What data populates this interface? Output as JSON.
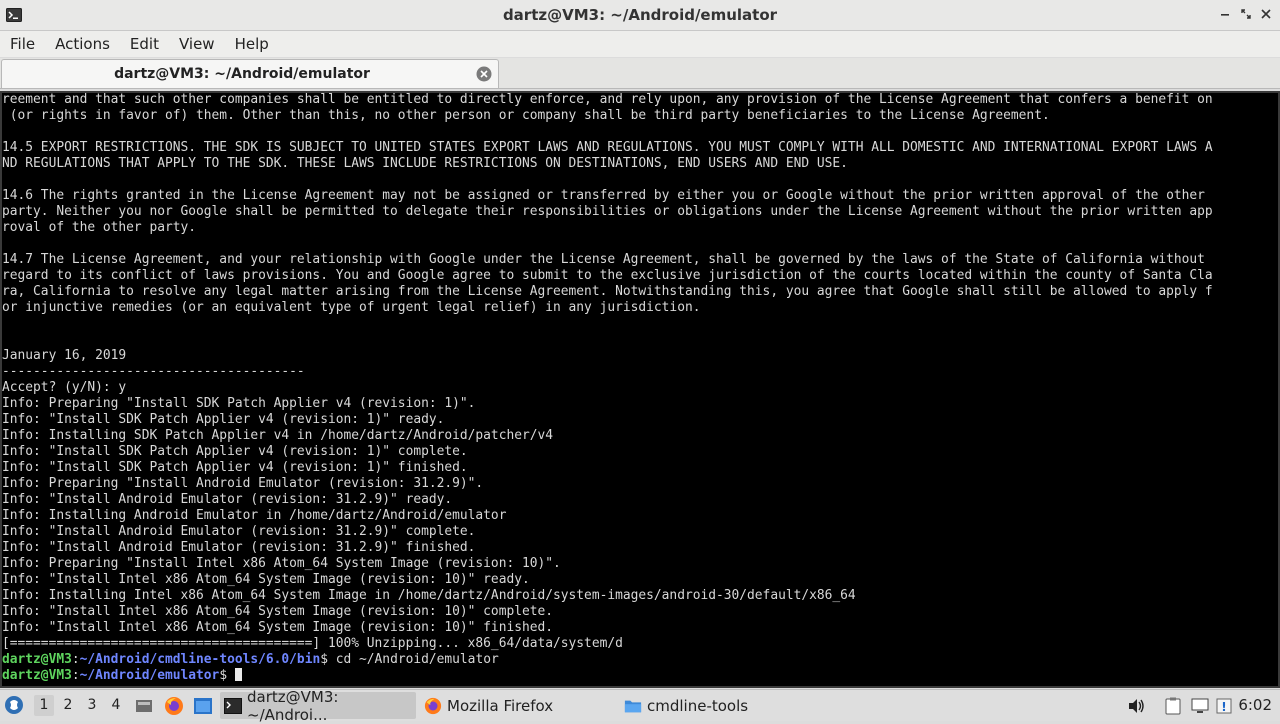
{
  "window": {
    "title": "dartz@VM3: ~/Android/emulator"
  },
  "menu": [
    "File",
    "Actions",
    "Edit",
    "View",
    "Help"
  ],
  "tab": {
    "label": "dartz@VM3: ~/Android/emulator"
  },
  "terminal": {
    "lines": [
      "reement and that such other companies shall be entitled to directly enforce, and rely upon, any provision of the License Agreement that confers a benefit on",
      " (or rights in favor of) them. Other than this, no other person or company shall be third party beneficiaries to the License Agreement.",
      "",
      "14.5 EXPORT RESTRICTIONS. THE SDK IS SUBJECT TO UNITED STATES EXPORT LAWS AND REGULATIONS. YOU MUST COMPLY WITH ALL DOMESTIC AND INTERNATIONAL EXPORT LAWS A",
      "ND REGULATIONS THAT APPLY TO THE SDK. THESE LAWS INCLUDE RESTRICTIONS ON DESTINATIONS, END USERS AND END USE.",
      "",
      "14.6 The rights granted in the License Agreement may not be assigned or transferred by either you or Google without the prior written approval of the other",
      "party. Neither you nor Google shall be permitted to delegate their responsibilities or obligations under the License Agreement without the prior written app",
      "roval of the other party.",
      "",
      "14.7 The License Agreement, and your relationship with Google under the License Agreement, shall be governed by the laws of the State of California without",
      "regard to its conflict of laws provisions. You and Google agree to submit to the exclusive jurisdiction of the courts located within the county of Santa Cla",
      "ra, California to resolve any legal matter arising from the License Agreement. Notwithstanding this, you agree that Google shall still be allowed to apply f",
      "or injunctive remedies (or an equivalent type of urgent legal relief) in any jurisdiction.",
      "",
      "",
      "January 16, 2019",
      "---------------------------------------",
      "Accept? (y/N): y",
      "Info: Preparing \"Install SDK Patch Applier v4 (revision: 1)\".",
      "Info: \"Install SDK Patch Applier v4 (revision: 1)\" ready.",
      "Info: Installing SDK Patch Applier v4 in /home/dartz/Android/patcher/v4",
      "Info: \"Install SDK Patch Applier v4 (revision: 1)\" complete.",
      "Info: \"Install SDK Patch Applier v4 (revision: 1)\" finished.",
      "Info: Preparing \"Install Android Emulator (revision: 31.2.9)\".",
      "Info: \"Install Android Emulator (revision: 31.2.9)\" ready.",
      "Info: Installing Android Emulator in /home/dartz/Android/emulator",
      "Info: \"Install Android Emulator (revision: 31.2.9)\" complete.",
      "Info: \"Install Android Emulator (revision: 31.2.9)\" finished.",
      "Info: Preparing \"Install Intel x86 Atom_64 System Image (revision: 10)\".",
      "Info: \"Install Intel x86 Atom_64 System Image (revision: 10)\" ready.",
      "Info: Installing Intel x86 Atom_64 System Image in /home/dartz/Android/system-images/android-30/default/x86_64",
      "Info: \"Install Intel x86 Atom_64 System Image (revision: 10)\" complete.",
      "Info: \"Install Intel x86 Atom_64 System Image (revision: 10)\" finished.",
      "[=======================================] 100% Unzipping... x86_64/data/system/d"
    ],
    "prompt1": {
      "user": "dartz@VM3",
      "colon": ":",
      "path": "~/Android/cmdline-tools/6.0/bin",
      "symbol": "$",
      "command": " cd ~/Android/emulator"
    },
    "prompt2": {
      "user": "dartz@VM3",
      "colon": ":",
      "path": "~/Android/emulator",
      "symbol": "$",
      "command": " "
    }
  },
  "taskbar": {
    "workspaces": [
      "1",
      "2",
      "3",
      "4"
    ],
    "tasks": [
      {
        "label": "dartz@VM3: ~/Androi...",
        "icon": "terminal-icon"
      },
      {
        "label": "Mozilla Firefox",
        "icon": "firefox-icon"
      },
      {
        "label": "cmdline-tools",
        "icon": "folder-icon"
      }
    ],
    "clock": "6:02"
  },
  "colors": {
    "terminal_bg": "#000000",
    "terminal_fg": "#d8d8d8",
    "prompt_user": "#5ed45e",
    "prompt_path": "#6f86ff"
  }
}
